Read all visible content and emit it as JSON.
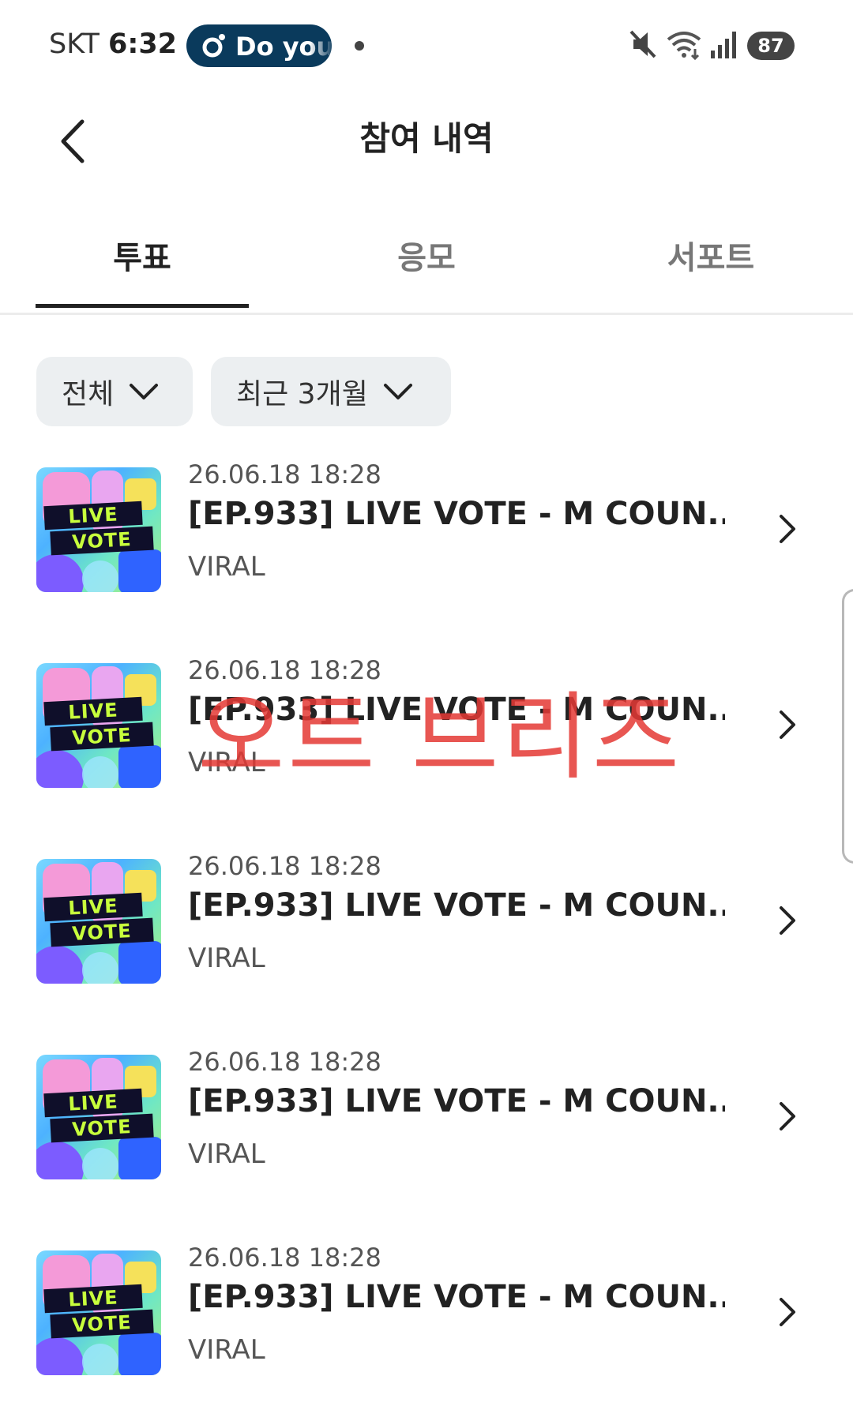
{
  "status_bar": {
    "carrier": "SKT",
    "time": "6:32",
    "notification_text": "Do you",
    "battery": "87",
    "icons": [
      "mute-icon",
      "wifi-icon",
      "signal-icon",
      "battery-icon"
    ]
  },
  "header": {
    "title": "참여 내역",
    "back_icon": "back-arrow-icon"
  },
  "tabs": [
    {
      "label": "투표",
      "active": true
    },
    {
      "label": "응모",
      "active": false
    },
    {
      "label": "서포트",
      "active": false
    }
  ],
  "filters": [
    {
      "label": "전체"
    },
    {
      "label": "최근 3개월"
    }
  ],
  "items": [
    {
      "date": "26.06.18 18:28",
      "title": "[EP.933] LIVE VOTE - M COUN...",
      "subtitle": "VIRAL",
      "thumb_line1": "LIVE",
      "thumb_line2": "VOTE"
    },
    {
      "date": "26.06.18 18:28",
      "title": "[EP.933] LIVE VOTE - M COUN...",
      "subtitle": "VIRAL",
      "thumb_line1": "LIVE",
      "thumb_line2": "VOTE"
    },
    {
      "date": "26.06.18 18:28",
      "title": "[EP.933] LIVE VOTE - M COUN...",
      "subtitle": "VIRAL",
      "thumb_line1": "LIVE",
      "thumb_line2": "VOTE"
    },
    {
      "date": "26.06.18 18:28",
      "title": "[EP.933] LIVE VOTE - M COUN...",
      "subtitle": "VIRAL",
      "thumb_line1": "LIVE",
      "thumb_line2": "VOTE"
    },
    {
      "date": "26.06.18 18:28",
      "title": "[EP.933] LIVE VOTE - M COUN...",
      "subtitle": "VIRAL",
      "thumb_line1": "LIVE",
      "thumb_line2": "VOTE"
    }
  ],
  "watermark": "오트 브리즈",
  "colors": {
    "accent_pill": "#0a3a5c",
    "watermark": "#e53935",
    "filter_bg": "#eceff1"
  }
}
